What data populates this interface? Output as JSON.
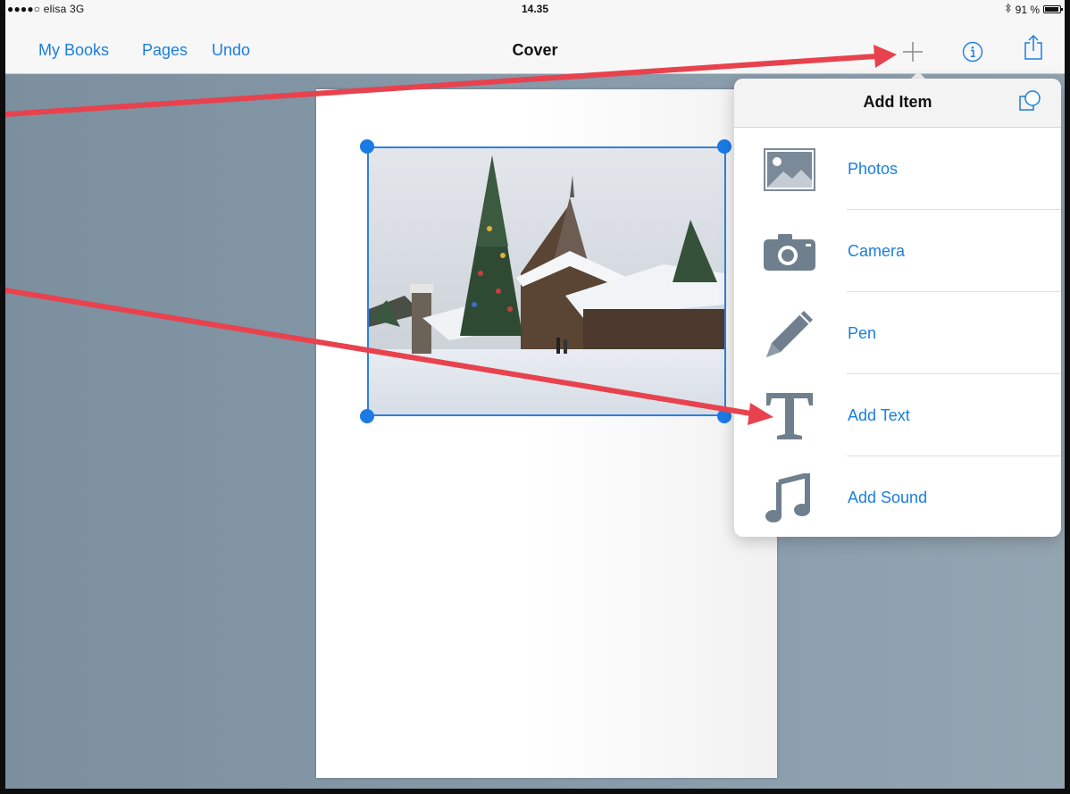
{
  "status_bar": {
    "carrier": "●●●●○ elisa  3G",
    "time": "14.35",
    "battery": "91 %",
    "battery_level": 0.91,
    "bluetooth_icon": "bluetooth-icon"
  },
  "nav": {
    "my_books": "My Books",
    "pages": "Pages",
    "undo": "Undo",
    "title": "Cover",
    "add_icon": "plus-icon",
    "info_icon": "info-icon",
    "share_icon": "share-icon"
  },
  "popover": {
    "title": "Add Item",
    "shapes_icon": "shapes-icon",
    "items": [
      {
        "label": "Photos",
        "icon": "photos-icon"
      },
      {
        "label": "Camera",
        "icon": "camera-icon"
      },
      {
        "label": "Pen",
        "icon": "pen-icon"
      },
      {
        "label": "Add Text",
        "icon": "text-icon"
      },
      {
        "label": "Add Sound",
        "icon": "music-note-icon"
      }
    ]
  },
  "colors": {
    "accent": "#1b7ee0",
    "annotation_arrow": "#e8424e",
    "selection": "#2f7fe0",
    "canvas": "#869aa9",
    "icon_gray": "#6f7f8d"
  }
}
